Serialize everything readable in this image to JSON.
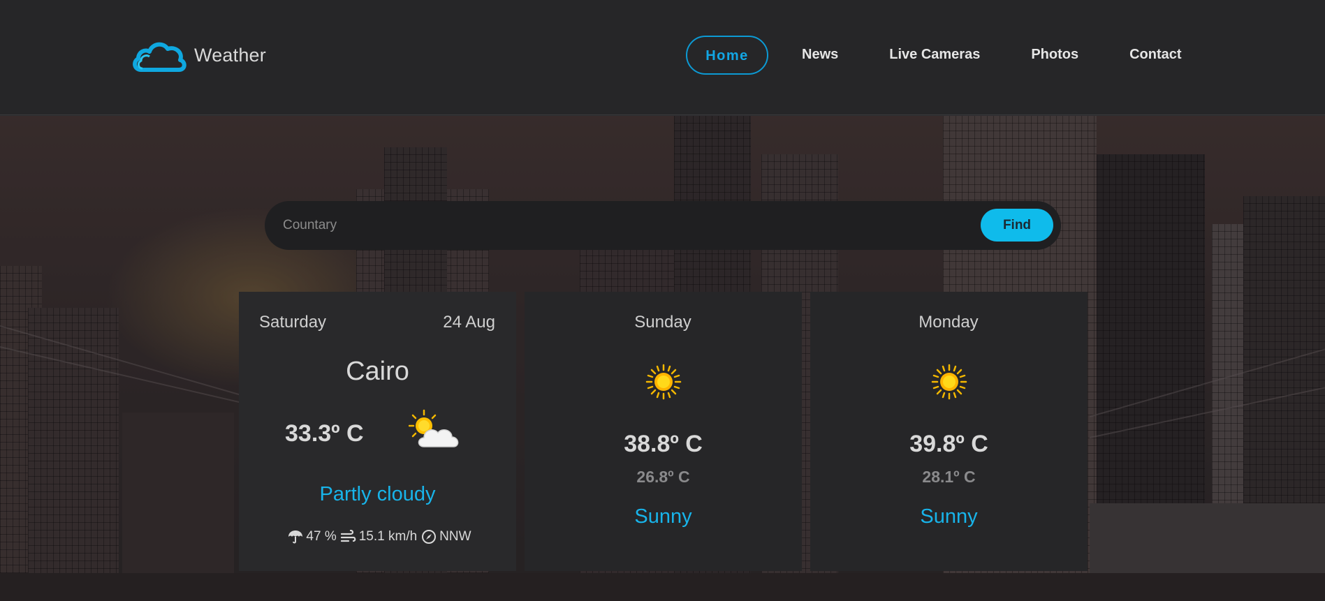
{
  "brand": {
    "name": "Weather",
    "icon": "cloud-icon",
    "accent": "#0fa8e0"
  },
  "nav": {
    "items": [
      {
        "label": "Home",
        "active": true
      },
      {
        "label": "News",
        "active": false
      },
      {
        "label": "Live Cameras",
        "active": false
      },
      {
        "label": "Photos",
        "active": false
      },
      {
        "label": "Contact",
        "active": false
      }
    ]
  },
  "search": {
    "placeholder": "Countary",
    "value": "",
    "button_label": "Find"
  },
  "forecast": {
    "today": {
      "day": "Saturday",
      "date": "24 Aug",
      "city": "Cairo",
      "temp": "33.3º C",
      "icon": "partly-cloudy-icon",
      "condition": "Partly cloudy",
      "humidity": "47 %",
      "wind_speed": "15.1 km/h",
      "wind_dir": "NNW"
    },
    "days": [
      {
        "day": "Sunday",
        "icon": "sun-icon",
        "max": "38.8º C",
        "min": "26.8º C",
        "condition": "Sunny"
      },
      {
        "day": "Monday",
        "icon": "sun-icon",
        "max": "39.8º C",
        "min": "28.1º C",
        "condition": "Sunny"
      }
    ]
  },
  "colors": {
    "accent": "#0fbbeb",
    "card_bg": "#262628",
    "nav_bg": "#262628"
  }
}
